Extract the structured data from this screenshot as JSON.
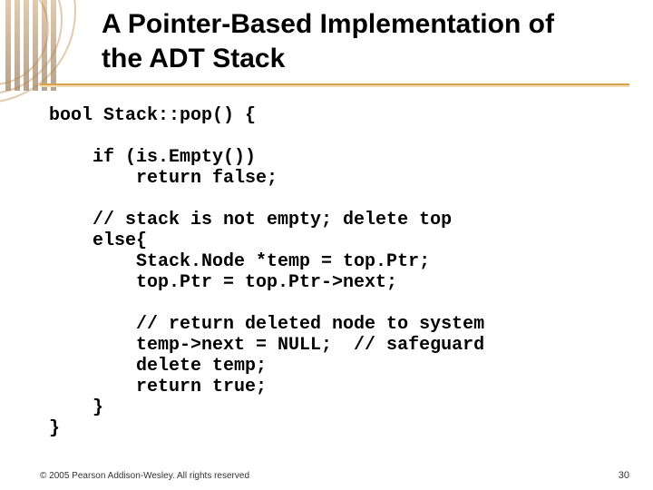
{
  "title": {
    "line1": "A Pointer-Based Implementation of",
    "line2": "the ADT Stack"
  },
  "code": {
    "l1": "bool Stack::pop() {",
    "l2": "",
    "l3": "    if (is.Empty())",
    "l4": "        return false;",
    "l5": "",
    "l6": "    // stack is not empty; delete top",
    "l7": "    else{",
    "l8": "        Stack.Node *temp = top.Ptr;",
    "l9": "        top.Ptr = top.Ptr->next;",
    "l10": "",
    "l11": "        // return deleted node to system",
    "l12": "        temp->next = NULL;  // safeguard",
    "l13": "        delete temp;",
    "l14": "        return true;",
    "l15": "    }",
    "l16": "}"
  },
  "footer": "© 2005 Pearson Addison-Wesley. All rights reserved",
  "page_number": "30"
}
